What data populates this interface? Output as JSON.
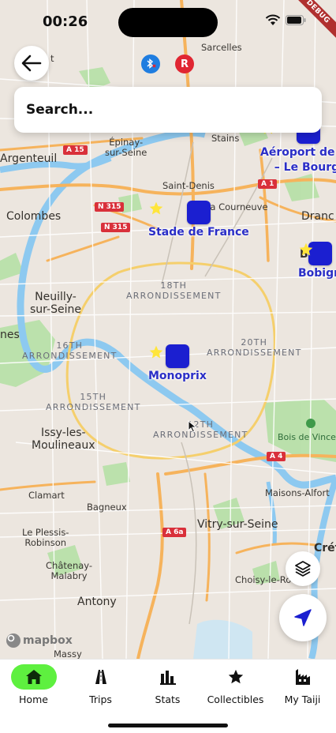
{
  "status_bar": {
    "time": "00:26",
    "debug_banner": "DEBUG"
  },
  "search": {
    "placeholder": "Search..."
  },
  "map": {
    "places": {
      "sarcelles": "Sarcelles",
      "epinay": "Épinay-\nsur-Seine",
      "stains": "Stains",
      "argenteuil": "Argenteuil",
      "saint_denis": "Saint-Denis",
      "la_courneuve": "La Courneuve",
      "colombes": "Colombes",
      "drancy": "Dranc",
      "bobigny_short": "Bo",
      "neuilly": "Neuilly-\nsur-Seine",
      "nes": "nes",
      "issy": "Issy-les-\nMoulineaux",
      "clamart": "Clamart",
      "bagneux": "Bagneux",
      "maisons_alfort": "Maisons-Alfort",
      "le_plessis": "Le Plessis-\nRobinson",
      "vitry": "Vitry-sur-Seine",
      "chatenay": "Châtenay-\nMalabry",
      "antony": "Antony",
      "creteil": "Crét",
      "choisy": "Choisy-le-Ro",
      "massy": "Massy",
      "bois_vincennes": "Bois de Vincen",
      "t_fragment": "t"
    },
    "arrondissements": {
      "a18": "18TH\nARRONDISSEMENT",
      "a16": "16TH\nARRONDISSEMENT",
      "a20": "20TH\nARRONDISSEMENT",
      "a15": "15TH\nARRONDISSEMENT",
      "a12": "12TH\nARRONDISSEMENT"
    },
    "road_shields": {
      "a15": "A 15",
      "a1": "A 1",
      "n315a": "N 315",
      "n315b": "N 315",
      "a4": "A 4",
      "a6a": "A 6a"
    },
    "pois": {
      "stade": "Stade de France",
      "monoprix": "Monoprix",
      "aeroport": "Aéroport de P\n– Le Bourge",
      "bobigny": "Bobign"
    },
    "attribution": "mapbox",
    "colors": {
      "poi": "#1b1fd0",
      "water": "#8dc9f0",
      "park": "#a9dc9c",
      "road": "#f6b35c",
      "nav_active": "#5ef03f"
    }
  },
  "nav": {
    "items": [
      {
        "label": "Home",
        "icon": "home-icon",
        "active": true
      },
      {
        "label": "Trips",
        "icon": "trips-icon",
        "active": false
      },
      {
        "label": "Stats",
        "icon": "stats-icon",
        "active": false
      },
      {
        "label": "Collectibles",
        "icon": "star-icon",
        "active": false
      },
      {
        "label": "My Taiji",
        "icon": "taiji-icon",
        "active": false
      }
    ]
  }
}
